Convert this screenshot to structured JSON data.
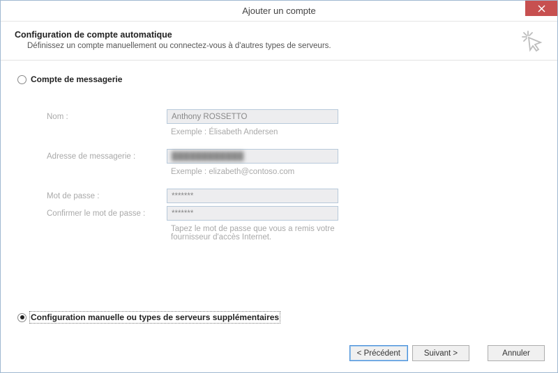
{
  "window": {
    "title": "Ajouter un compte"
  },
  "header": {
    "title": "Configuration de compte automatique",
    "subtitle": "Définissez un compte manuellement ou connectez-vous à d'autres types de serveurs."
  },
  "options": {
    "email_account_label": "Compte de messagerie",
    "manual_label": "Configuration manuelle ou types de serveurs supplémentaires",
    "selected": "manual"
  },
  "form": {
    "name": {
      "label": "Nom :",
      "value": "Anthony ROSSETTO",
      "hint": "Exemple : Élisabeth Andersen"
    },
    "email": {
      "label": "Adresse de messagerie :",
      "value": "████████████",
      "hint": "Exemple : elizabeth@contoso.com"
    },
    "password": {
      "label": "Mot de passe :",
      "value": "*******"
    },
    "confirm": {
      "label": "Confirmer le mot de passe :",
      "value": "*******",
      "hint": "Tapez le mot de passe que vous a remis votre fournisseur d'accès Internet."
    }
  },
  "buttons": {
    "back": "< Précédent",
    "next": "Suivant >",
    "cancel": "Annuler"
  }
}
